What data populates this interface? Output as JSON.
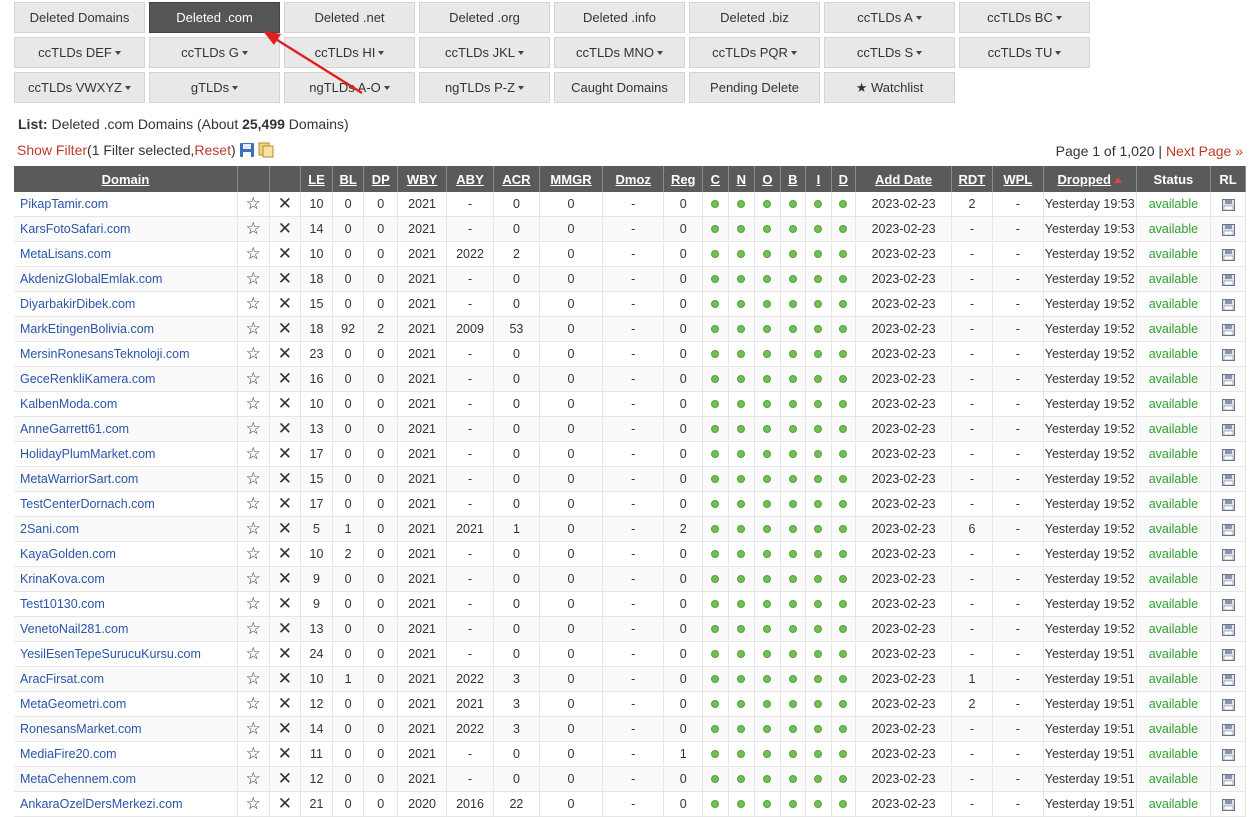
{
  "tabs": [
    {
      "label": "Deleted Domains",
      "active": false,
      "caret": false
    },
    {
      "label": "Deleted .com",
      "active": true,
      "caret": false
    },
    {
      "label": "Deleted .net",
      "active": false,
      "caret": false
    },
    {
      "label": "Deleted .org",
      "active": false,
      "caret": false
    },
    {
      "label": "Deleted .info",
      "active": false,
      "caret": false
    },
    {
      "label": "Deleted .biz",
      "active": false,
      "caret": false
    },
    {
      "label": "ccTLDs A",
      "active": false,
      "caret": true
    },
    {
      "label": "ccTLDs BC",
      "active": false,
      "caret": true
    },
    {
      "label": "ccTLDs DEF",
      "active": false,
      "caret": true
    },
    {
      "label": "ccTLDs G",
      "active": false,
      "caret": true
    },
    {
      "label": "ccTLDs HI",
      "active": false,
      "caret": true
    },
    {
      "label": "ccTLDs JKL",
      "active": false,
      "caret": true
    },
    {
      "label": "ccTLDs MNO",
      "active": false,
      "caret": true
    },
    {
      "label": "ccTLDs PQR",
      "active": false,
      "caret": true
    },
    {
      "label": "ccTLDs S",
      "active": false,
      "caret": true
    },
    {
      "label": "ccTLDs TU",
      "active": false,
      "caret": true
    },
    {
      "label": "ccTLDs VWXYZ",
      "active": false,
      "caret": true
    },
    {
      "label": "gTLDs",
      "active": false,
      "caret": true
    },
    {
      "label": "ngTLDs A-O",
      "active": false,
      "caret": true
    },
    {
      "label": "ngTLDs P-Z",
      "active": false,
      "caret": true
    },
    {
      "label": "Caught Domains",
      "active": false,
      "caret": false
    },
    {
      "label": "Pending Delete",
      "active": false,
      "caret": false
    },
    {
      "label": "★ Watchlist",
      "active": false,
      "caret": false
    }
  ],
  "list": {
    "label": "List:",
    "text_before": " Deleted .com Domains (About ",
    "count": "25,499",
    "text_after": " Domains)"
  },
  "filter": {
    "show_label": "Show Filter",
    "selected_text": " (1 Filter selected, ",
    "reset_label": "Reset",
    "close_paren": ")"
  },
  "pager": {
    "text": "Page 1 of 1,020 | ",
    "next_label": "Next Page »"
  },
  "columns": [
    "Domain",
    "",
    "",
    "LE",
    "BL",
    "DP",
    "WBY",
    "ABY",
    "ACR",
    "MMGR",
    "Dmoz",
    "Reg",
    "C",
    "N",
    "O",
    "B",
    "I",
    "D",
    "Add Date",
    "RDT",
    "WPL",
    "Dropped",
    "Status",
    "RL"
  ],
  "rows": [
    [
      "PikapTamir.com",
      "10",
      "0",
      "0",
      "2021",
      "-",
      "0",
      "0",
      "-",
      "0",
      "2023-02-23",
      "2",
      "-",
      "Yesterday 19:53",
      "available"
    ],
    [
      "KarsFotoSafari.com",
      "14",
      "0",
      "0",
      "2021",
      "-",
      "0",
      "0",
      "-",
      "0",
      "2023-02-23",
      "-",
      "-",
      "Yesterday 19:53",
      "available"
    ],
    [
      "MetaLisans.com",
      "10",
      "0",
      "0",
      "2021",
      "2022",
      "2",
      "0",
      "-",
      "0",
      "2023-02-23",
      "-",
      "-",
      "Yesterday 19:52",
      "available"
    ],
    [
      "AkdenizGlobalEmlak.com",
      "18",
      "0",
      "0",
      "2021",
      "-",
      "0",
      "0",
      "-",
      "0",
      "2023-02-23",
      "-",
      "-",
      "Yesterday 19:52",
      "available"
    ],
    [
      "DiyarbakirDibek.com",
      "15",
      "0",
      "0",
      "2021",
      "-",
      "0",
      "0",
      "-",
      "0",
      "2023-02-23",
      "-",
      "-",
      "Yesterday 19:52",
      "available"
    ],
    [
      "MarkEtingenBolivia.com",
      "18",
      "92",
      "2",
      "2021",
      "2009",
      "53",
      "0",
      "-",
      "0",
      "2023-02-23",
      "-",
      "-",
      "Yesterday 19:52",
      "available"
    ],
    [
      "MersinRonesansTeknoloji.com",
      "23",
      "0",
      "0",
      "2021",
      "-",
      "0",
      "0",
      "-",
      "0",
      "2023-02-23",
      "-",
      "-",
      "Yesterday 19:52",
      "available"
    ],
    [
      "GeceRenkliKamera.com",
      "16",
      "0",
      "0",
      "2021",
      "-",
      "0",
      "0",
      "-",
      "0",
      "2023-02-23",
      "-",
      "-",
      "Yesterday 19:52",
      "available"
    ],
    [
      "KalbenModa.com",
      "10",
      "0",
      "0",
      "2021",
      "-",
      "0",
      "0",
      "-",
      "0",
      "2023-02-23",
      "-",
      "-",
      "Yesterday 19:52",
      "available"
    ],
    [
      "AnneGarrett61.com",
      "13",
      "0",
      "0",
      "2021",
      "-",
      "0",
      "0",
      "-",
      "0",
      "2023-02-23",
      "-",
      "-",
      "Yesterday 19:52",
      "available"
    ],
    [
      "HolidayPlumMarket.com",
      "17",
      "0",
      "0",
      "2021",
      "-",
      "0",
      "0",
      "-",
      "0",
      "2023-02-23",
      "-",
      "-",
      "Yesterday 19:52",
      "available"
    ],
    [
      "MetaWarriorSart.com",
      "15",
      "0",
      "0",
      "2021",
      "-",
      "0",
      "0",
      "-",
      "0",
      "2023-02-23",
      "-",
      "-",
      "Yesterday 19:52",
      "available"
    ],
    [
      "TestCenterDornach.com",
      "17",
      "0",
      "0",
      "2021",
      "-",
      "0",
      "0",
      "-",
      "0",
      "2023-02-23",
      "-",
      "-",
      "Yesterday 19:52",
      "available"
    ],
    [
      "2Sani.com",
      "5",
      "1",
      "0",
      "2021",
      "2021",
      "1",
      "0",
      "-",
      "2",
      "2023-02-23",
      "6",
      "-",
      "Yesterday 19:52",
      "available"
    ],
    [
      "KayaGolden.com",
      "10",
      "2",
      "0",
      "2021",
      "-",
      "0",
      "0",
      "-",
      "0",
      "2023-02-23",
      "-",
      "-",
      "Yesterday 19:52",
      "available"
    ],
    [
      "KrinaKova.com",
      "9",
      "0",
      "0",
      "2021",
      "-",
      "0",
      "0",
      "-",
      "0",
      "2023-02-23",
      "-",
      "-",
      "Yesterday 19:52",
      "available"
    ],
    [
      "Test10130.com",
      "9",
      "0",
      "0",
      "2021",
      "-",
      "0",
      "0",
      "-",
      "0",
      "2023-02-23",
      "-",
      "-",
      "Yesterday 19:52",
      "available"
    ],
    [
      "VenetoNail281.com",
      "13",
      "0",
      "0",
      "2021",
      "-",
      "0",
      "0",
      "-",
      "0",
      "2023-02-23",
      "-",
      "-",
      "Yesterday 19:52",
      "available"
    ],
    [
      "YesilEsenTepeSurucuKursu.com",
      "24",
      "0",
      "0",
      "2021",
      "-",
      "0",
      "0",
      "-",
      "0",
      "2023-02-23",
      "-",
      "-",
      "Yesterday 19:51",
      "available"
    ],
    [
      "AracFirsat.com",
      "10",
      "1",
      "0",
      "2021",
      "2022",
      "3",
      "0",
      "-",
      "0",
      "2023-02-23",
      "1",
      "-",
      "Yesterday 19:51",
      "available"
    ],
    [
      "MetaGeometri.com",
      "12",
      "0",
      "0",
      "2021",
      "2021",
      "3",
      "0",
      "-",
      "0",
      "2023-02-23",
      "2",
      "-",
      "Yesterday 19:51",
      "available"
    ],
    [
      "RonesansMarket.com",
      "14",
      "0",
      "0",
      "2021",
      "2022",
      "3",
      "0",
      "-",
      "0",
      "2023-02-23",
      "-",
      "-",
      "Yesterday 19:51",
      "available"
    ],
    [
      "MediaFire20.com",
      "11",
      "0",
      "0",
      "2021",
      "-",
      "0",
      "0",
      "-",
      "1",
      "2023-02-23",
      "-",
      "-",
      "Yesterday 19:51",
      "available"
    ],
    [
      "MetaCehennem.com",
      "12",
      "0",
      "0",
      "2021",
      "-",
      "0",
      "0",
      "-",
      "0",
      "2023-02-23",
      "-",
      "-",
      "Yesterday 19:51",
      "available"
    ],
    [
      "AnkaraOzelDersMerkezi.com",
      "21",
      "0",
      "0",
      "2020",
      "2016",
      "22",
      "0",
      "-",
      "0",
      "2023-02-23",
      "-",
      "-",
      "Yesterday 19:51",
      "available"
    ]
  ],
  "icons": {
    "star": "star-outline-icon",
    "remove": "close-icon",
    "status_dot": "green-dot-icon",
    "rl": "floppy-icon"
  },
  "colors": {
    "accent_link": "#c0392b",
    "header_bg": "#5a5a5a",
    "available": "#2e9e2e",
    "dot": "#6fc052",
    "active_tab": "#555555"
  }
}
